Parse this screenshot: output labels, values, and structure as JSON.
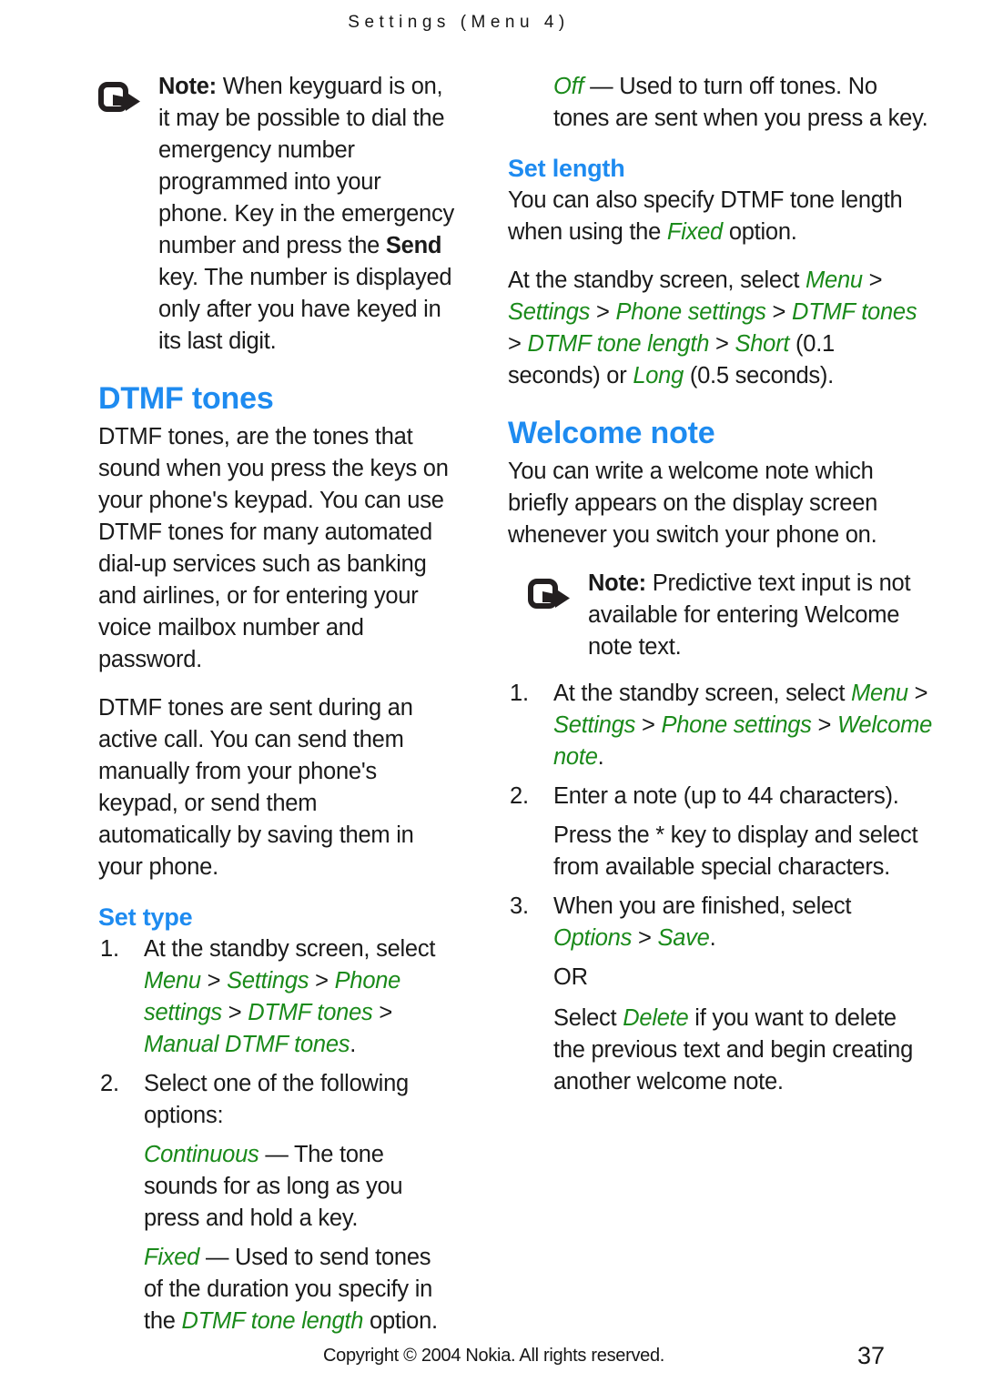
{
  "header": {
    "running_title": "Settings (Menu 4)"
  },
  "colors": {
    "heading_blue": "#1E8BF0",
    "nav_green": "#1a8a1a",
    "body_black": "#1a1a1a"
  },
  "left_column": {
    "note": {
      "icon": "note-arrow-icon",
      "label": "Note:",
      "text_before_bold": " When keyguard is on, it may be possible to dial the emergency number programmed into your phone. Key in the emergency number and press the ",
      "bold_word": "Send",
      "text_after_bold": " key. The number is displayed only after you have keyed in its last digit."
    },
    "section_title": "DTMF tones",
    "paragraph_1": " DTMF tones, are the tones that sound when you press the keys on your phone's keypad. You can use DTMF tones for many automated dial-up services such as banking and airlines, or for entering your voice mailbox number and password.",
    "paragraph_2": "DTMF tones are sent during an active call. You can send them manually from your phone's keypad, or send them automatically by saving them in your phone.",
    "sub_title": "Set type",
    "step1_text": "At the standby screen, select",
    "step1_nav": {
      "p1": "Menu",
      "s1": ">",
      "p2": "Settings",
      "s2": ">",
      "p3": "Phone settings",
      "s3": ">",
      "p4": "DTMF tones",
      "s4": ">",
      "p5": "Manual DTMF tones",
      "period": "."
    },
    "step2_text": "Select one of the following options:",
    "option_continuous": {
      "term": "Continuous",
      "dash": " — ",
      "desc": "The tone sounds for as long as you press and hold a key."
    },
    "option_fixed": {
      "term": "Fixed",
      "dash": " — ",
      "desc_before": "Used to send tones of the duration you specify in the ",
      "nav_term": "DTMF tone length",
      "desc_after": " option."
    }
  },
  "right_column": {
    "option_off": {
      "term": "Off",
      "dash": " — ",
      "desc": "Used to turn off tones. No tones are sent when you press a key."
    },
    "sub_title_set_length": "Set length",
    "set_length_para": {
      "before": "You can also specify DTMF tone length when using the ",
      "nav_term": "Fixed",
      "after": " option."
    },
    "set_length_path": {
      "lead": "At the standby screen, select ",
      "p1": "Menu",
      "s1": ">",
      "p2": "Settings",
      "s2": ">",
      "p3": "Phone settings",
      "s3": ">",
      "p4": "DTMF tones",
      "s4": ">",
      "p5": "DTMF tone length",
      "s5": ">",
      "p6": "Short",
      "mid": " (0.1 seconds) or ",
      "p7": "Long",
      "tail": " (0.5 seconds)."
    },
    "section_title_welcome": "Welcome note",
    "welcome_para": "You can write a welcome note which briefly appears on the display screen whenever you switch your phone on.",
    "note": {
      "icon": "note-arrow-icon",
      "label": "Note:",
      "text": " Predictive text input is not available for entering Welcome note text."
    },
    "step1_text": "At the standby screen, select",
    "step1_nav": {
      "p1": "Menu",
      "s1": ">",
      "p2": "Settings",
      "s2": ">",
      "p3": "Phone settings",
      "s3": ">",
      "p4": "Welcome note",
      "period": "."
    },
    "step2_text": "Enter a note (up to 44 characters).",
    "step2_sub": "Press the * key to display and select from available special characters.",
    "step3_text": "When you are finished, select",
    "step3_nav": {
      "p1": "Options",
      "s1": ">",
      "p2": "Save",
      "period": "."
    },
    "or_label": "OR",
    "delete_para": {
      "before": "Select ",
      "nav_term": "Delete",
      "after": " if you want to delete the previous text and begin creating another welcome note."
    }
  },
  "footer": {
    "copyright": "Copyright © 2004 Nokia. All rights reserved.",
    "page_number": "37"
  }
}
